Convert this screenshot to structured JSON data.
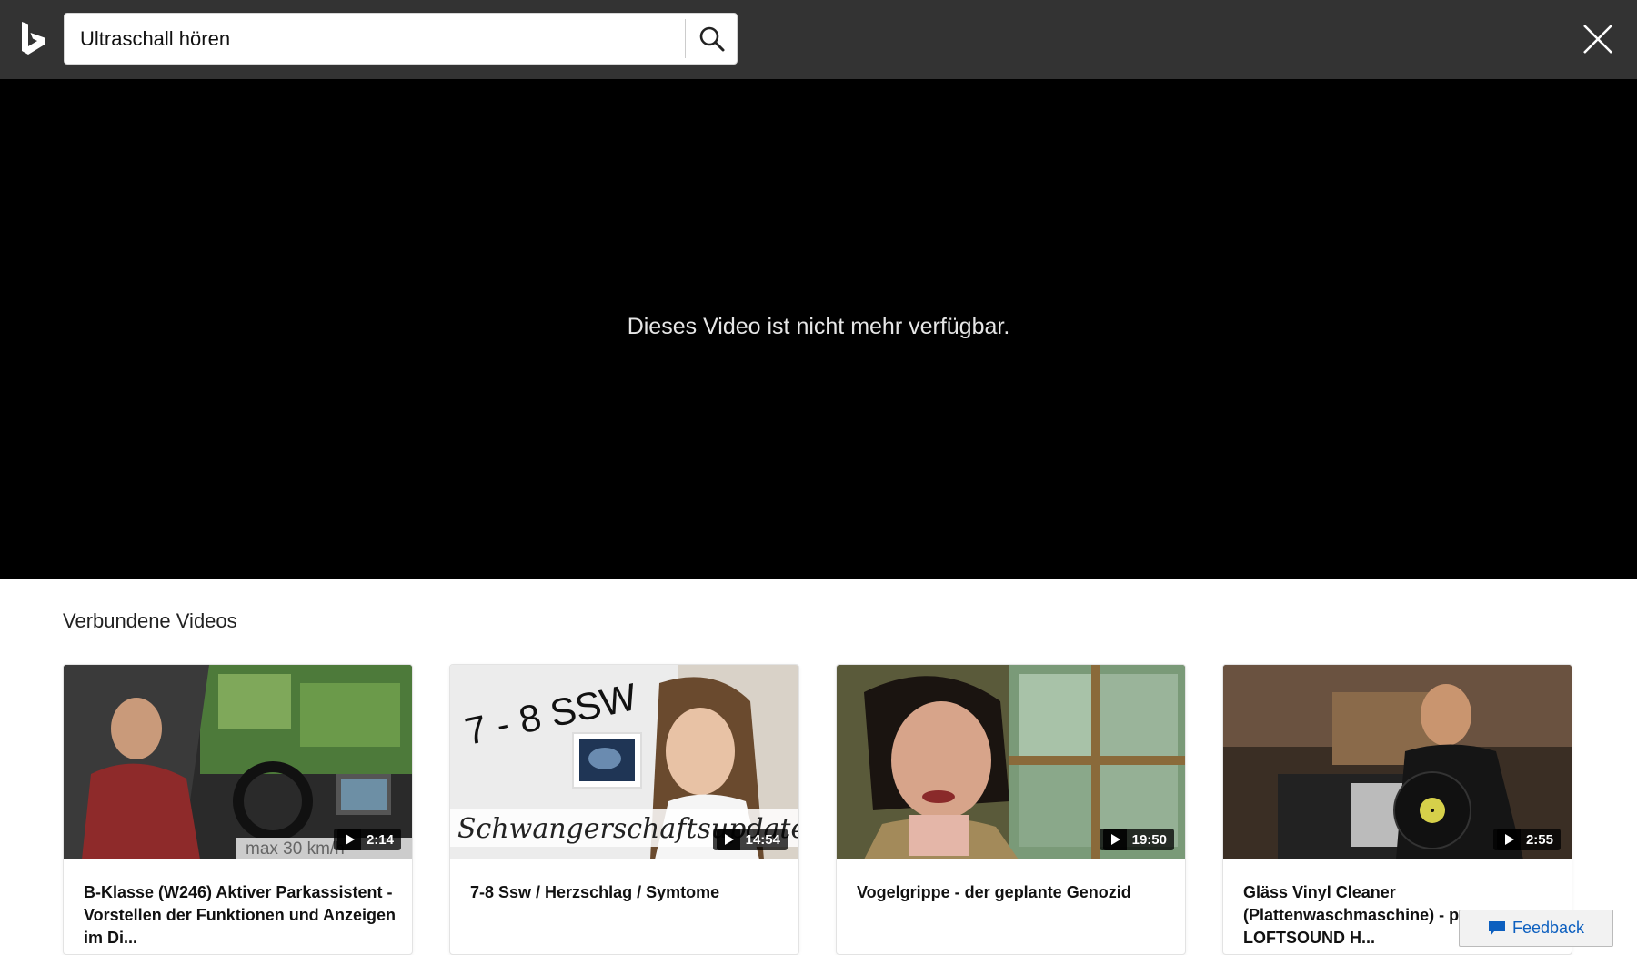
{
  "header": {
    "logo_icon": "bing-logo-icon",
    "search_value": "Ultraschall hören",
    "search_icon": "search-icon",
    "close_icon": "close-icon"
  },
  "player": {
    "message": "Dieses Video ist nicht mehr verfügbar."
  },
  "related": {
    "title": "Verbundene Videos",
    "videos": [
      {
        "title": "B-Klasse (W246) Aktiver Parkassistent - Vorstellen der Funktionen und Anzeigen im Di...",
        "duration": "2:14",
        "overlay_text": "max 30 km/h"
      },
      {
        "title": "7-8 Ssw / Herzschlag / Symtome",
        "duration": "14:54",
        "overlay_text_top": "7 - 8 SSW",
        "overlay_text_bottom": "Schwangerschaftsupdate"
      },
      {
        "title": "Vogelgrippe - der geplante Genozid",
        "duration": "19:50"
      },
      {
        "title": "Gläss Vinyl Cleaner (Plattenwaschmaschine) - p... von LOFTSOUND H...",
        "duration": "2:55"
      }
    ]
  },
  "feedback": {
    "label": "Feedback",
    "icon": "speech-bubble-icon",
    "color": "#0c5fbf"
  },
  "colors": {
    "topbar": "#333333",
    "player_bg": "#000000"
  }
}
